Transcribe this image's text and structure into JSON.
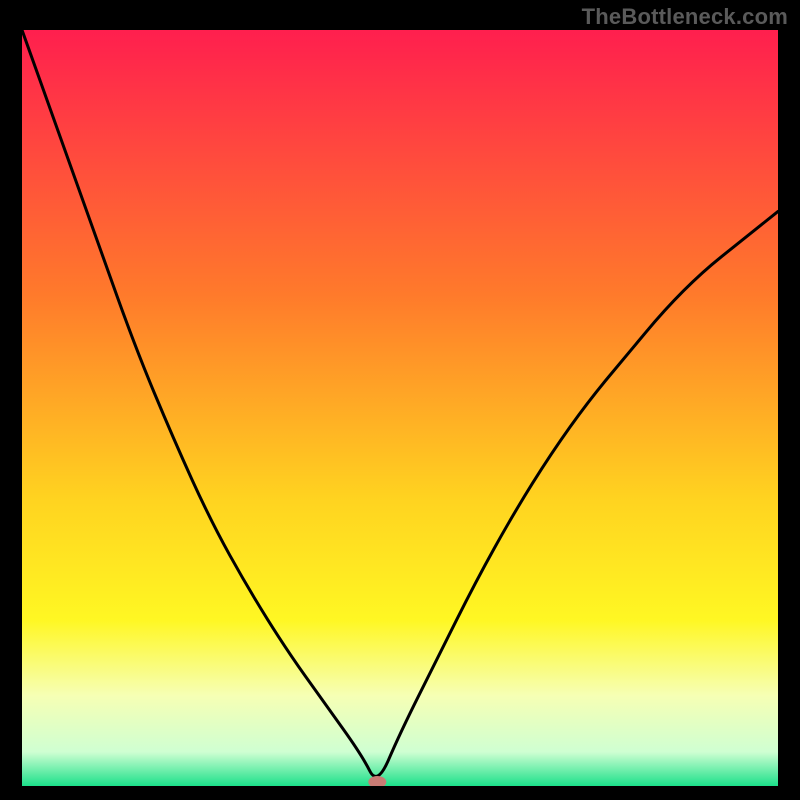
{
  "watermark": "TheBottleneck.com",
  "chart_data": {
    "type": "line",
    "title": "",
    "xlabel": "",
    "ylabel": "",
    "xlim": [
      0,
      100
    ],
    "ylim": [
      0,
      100
    ],
    "grid": false,
    "series": [
      {
        "name": "curve",
        "x": [
          0,
          5,
          10,
          15,
          20,
          25,
          30,
          35,
          40,
          45,
          47,
          50,
          55,
          60,
          65,
          70,
          75,
          80,
          85,
          90,
          95,
          100
        ],
        "values": [
          100,
          86,
          72,
          58,
          46,
          35,
          26,
          18,
          11,
          4,
          0,
          7,
          17,
          27,
          36,
          44,
          51,
          57,
          63,
          68,
          72,
          76
        ]
      }
    ],
    "marker": {
      "x": 47,
      "y": 0,
      "color": "#c97b74"
    },
    "background_gradient": {
      "stops": [
        {
          "pos": 0.0,
          "color": "#ff1f4e"
        },
        {
          "pos": 0.35,
          "color": "#ff7a2b"
        },
        {
          "pos": 0.62,
          "color": "#ffd320"
        },
        {
          "pos": 0.78,
          "color": "#fff723"
        },
        {
          "pos": 0.88,
          "color": "#f6ffb4"
        },
        {
          "pos": 0.955,
          "color": "#cfffd2"
        },
        {
          "pos": 1.0,
          "color": "#1ce08a"
        }
      ]
    }
  }
}
